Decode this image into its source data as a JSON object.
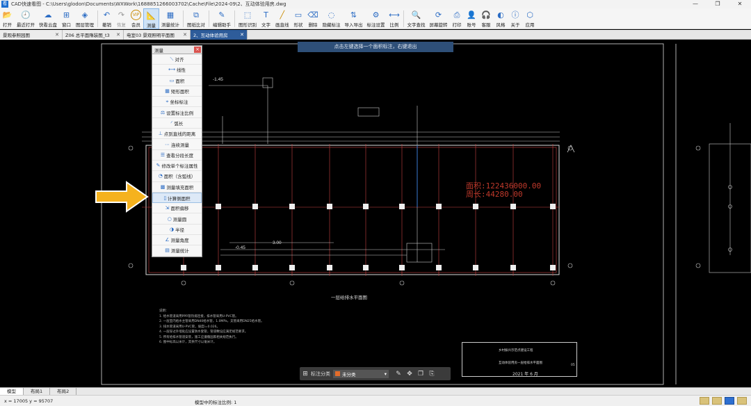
{
  "window": {
    "title": "CAD快速看图 - C:\\Users\\glodon\\Documents\\WXWork\\1688851266003702\\Cache\\File\\2024-09\\2、互动体验用房.dwg",
    "app_icon": "看"
  },
  "toolbar": {
    "items": [
      {
        "label": "打开",
        "icon": "📂"
      },
      {
        "label": "最近打开",
        "icon": "🕘"
      },
      {
        "label": "快看云盘",
        "icon": "☁"
      },
      {
        "label": "窗口",
        "icon": "⊞"
      },
      {
        "label": "图层管理",
        "icon": "◈"
      },
      {
        "label": "撤销",
        "icon": "↶"
      },
      {
        "label": "恢复",
        "icon": "↷"
      },
      {
        "label": "会员",
        "icon": "VIP"
      },
      {
        "label": "测量",
        "icon": "📐"
      },
      {
        "label": "测量统计",
        "icon": "▦"
      },
      {
        "label": "图纸比对",
        "icon": "⧉"
      },
      {
        "label": "编辑助手",
        "icon": "✎"
      },
      {
        "label": "图形识别",
        "icon": "⬚"
      },
      {
        "label": "文字",
        "icon": "T"
      },
      {
        "label": "画直线",
        "icon": "╱"
      },
      {
        "label": "形状",
        "icon": "▭"
      },
      {
        "label": "删除",
        "icon": "⌫"
      },
      {
        "label": "隐藏标注",
        "icon": "◌"
      },
      {
        "label": "导入导出",
        "icon": "⇅"
      },
      {
        "label": "标注设置",
        "icon": "⚙"
      },
      {
        "label": "比例",
        "icon": "⟷"
      },
      {
        "label": "文字查找",
        "icon": "🔍"
      },
      {
        "label": "屏幕旋转",
        "icon": "⟳"
      },
      {
        "label": "打印",
        "icon": "⎙"
      },
      {
        "label": "账号",
        "icon": "👤"
      },
      {
        "label": "客服",
        "icon": "🎧"
      },
      {
        "label": "风格",
        "icon": "◐"
      },
      {
        "label": "关于",
        "icon": "ⓘ"
      },
      {
        "label": "应用",
        "icon": "⬡"
      }
    ]
  },
  "tabs": [
    {
      "label": "景观参照园图"
    },
    {
      "label": "Z06 总平面隋装图_t3"
    },
    {
      "label": "电室03 景观照明平面图"
    },
    {
      "label": "2、互动体验用房"
    }
  ],
  "hint": "点击左键选择一个面积标注，右键退出",
  "measure_panel": {
    "title": "测量",
    "items": [
      {
        "label": "对齐",
        "icon": "⟍"
      },
      {
        "label": "线性",
        "icon": "⟷"
      },
      {
        "label": "面积",
        "icon": "▭"
      },
      {
        "label": "矩形面积",
        "icon": "▦"
      },
      {
        "label": "坐标标注",
        "icon": "⌖"
      },
      {
        "label": "设置标注比例",
        "icon": "⚖"
      },
      {
        "label": "弧长",
        "icon": "◜"
      },
      {
        "label": "点到直线的距离",
        "icon": "⊥"
      },
      {
        "label": "连续测量",
        "icon": "⋯"
      },
      {
        "label": "查看分段长度",
        "icon": "☰"
      },
      {
        "label": "修改单个标注属性",
        "icon": "✎"
      },
      {
        "label": "面积（含弧线）",
        "icon": "◔"
      },
      {
        "label": "测量填充面积",
        "icon": "▩"
      },
      {
        "label": "计算侧面积",
        "icon": "▯"
      },
      {
        "label": "面积偏移",
        "icon": "⇲"
      },
      {
        "label": "测量圆",
        "icon": "○"
      },
      {
        "label": "半径",
        "icon": "◑"
      },
      {
        "label": "测量角度",
        "icon": "∠"
      },
      {
        "label": "测量统计",
        "icon": "▤"
      }
    ],
    "selected_index": 13
  },
  "drawing": {
    "area_line1": "面积:122436000.00",
    "area_line2": "周长:44280.00",
    "plan_title": "一层给排水平面图",
    "elev1": "-1.45",
    "elev2": "-0.45",
    "elev3": "3.00",
    "notes_title": "说明：",
    "notes": [
      "1. 给水管道采用PPR管热熔连接，排水管采用U-PVC管。",
      "2. 一层室内给水主管采用DN40给水管，1.0MPa，支管采用DN25给水管。",
      "3. 排水管道采用U-PVC管，坡度i=0.026。",
      "4. 一层穿过外墙处应设置防水套管，管道敷设应满足规范要求。",
      "5. 所有给排水管道安装，施工应遵循国家相关规范执行。",
      "6. 图中标高以米计，其余尺寸以毫米计。"
    ],
    "titleblock": {
      "project": "乡村振兴示范点建设工程",
      "drawing": "互动体验用房一层给排水平面图",
      "date": "2021 年 6 月",
      "sheet": "05"
    }
  },
  "bottom_toolbar": {
    "label": "标注分类",
    "selected": "未分类",
    "swatch": "#e36c2a"
  },
  "sheets": [
    "模型",
    "布局1",
    "布局2"
  ],
  "status": {
    "coords": "x = 17005  y = 95707",
    "scale": "模型中的标注比例: 1"
  },
  "colors": {
    "area_text": "#c0392b",
    "hint_bg": "#2e4f78",
    "active_tab": "#2e5c9a",
    "arrow": "#f5b21e"
  }
}
